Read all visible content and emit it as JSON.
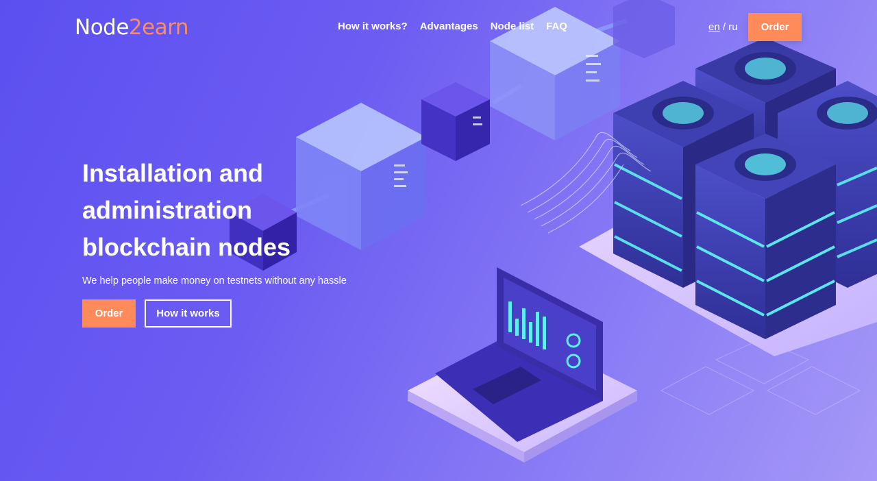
{
  "brand": {
    "name_part1": "Node",
    "name_part2": "2",
    "name_part3": "earn"
  },
  "nav": {
    "items": [
      {
        "label": "How it works?"
      },
      {
        "label": "Advantages"
      },
      {
        "label": "Node list"
      },
      {
        "label": "FAQ"
      }
    ]
  },
  "lang": {
    "en": "en",
    "separator": "/",
    "ru": "ru",
    "active": "en"
  },
  "header": {
    "order_label": "Order"
  },
  "hero": {
    "headline": "Installation and administration blockchain nodes",
    "subtitle": "We help people make money on testnets without any hassle",
    "order_label": "Order",
    "how_label": "How it works"
  },
  "colors": {
    "accent": "#ff8a5a",
    "bg_start": "#5b4ff0",
    "bg_end": "#a598f7",
    "cyan_glow": "#5ef0f0"
  },
  "illustration": {
    "icons": [
      "blockchain-cubes",
      "server-stack",
      "laptop-dashboard",
      "data-stream"
    ]
  }
}
